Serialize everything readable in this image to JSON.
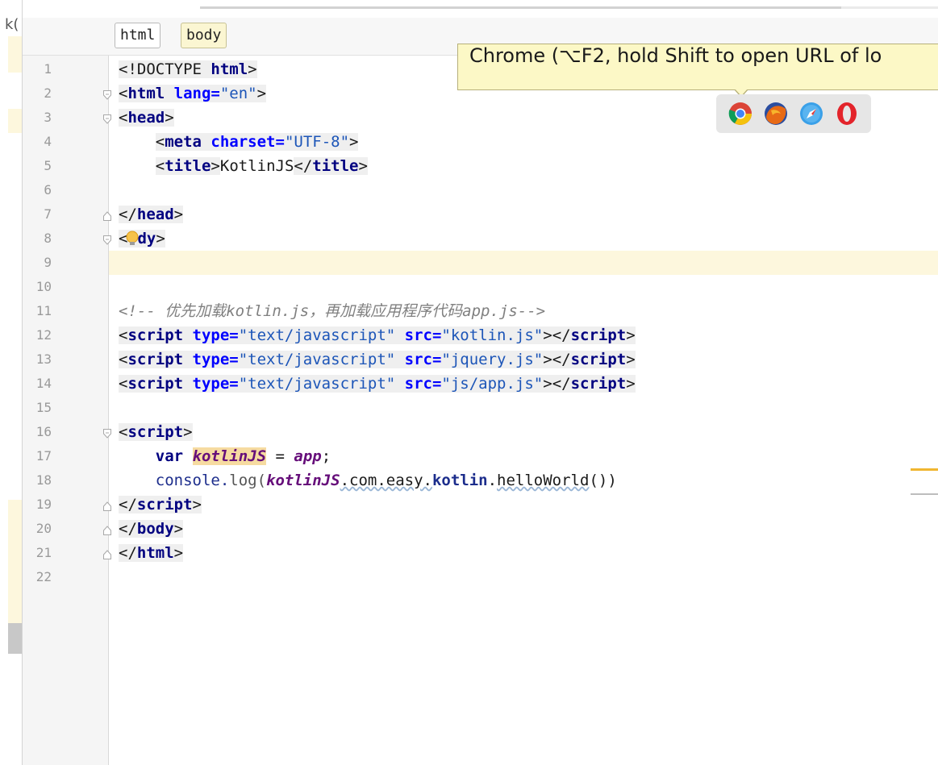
{
  "left_panel_label": "k(",
  "breadcrumbs": [
    "html",
    "body"
  ],
  "tooltip": "Chrome (⌥F2, hold Shift to open URL of lo",
  "browsers": [
    {
      "name": "chrome-icon"
    },
    {
      "name": "firefox-icon"
    },
    {
      "name": "safari-icon"
    },
    {
      "name": "opera-icon"
    }
  ],
  "line_numbers": [
    "1",
    "2",
    "3",
    "4",
    "5",
    "6",
    "7",
    "8",
    "9",
    "10",
    "11",
    "12",
    "13",
    "14",
    "15",
    "16",
    "17",
    "18",
    "19",
    "20",
    "21",
    "22"
  ],
  "code": {
    "l1_doctype": "<!DOCTYPE ",
    "l1_html": "html",
    "l1_end": ">",
    "l2_open": "<",
    "l2_tag": "html",
    "l2_attr": " lang=",
    "l2_val": "\"en\"",
    "l2_end": ">",
    "l3": "head",
    "l4_tag": "meta",
    "l4_attr": " charset=",
    "l4_val": "\"UTF-8\"",
    "l5_title_open": "title",
    "l5_text": "KotlinJS",
    "l5_title_close": "title",
    "l7": "head",
    "l8_pre": "<",
    "l8_post": "dy",
    "l11": "<!-- 优先加载kotlin.js，再加载应用程序代码app.js-->",
    "script_tag": "script",
    "type_attr": " type=",
    "type_val": "\"text/javascript\"",
    "src_attr": " src=",
    "l12_src": "\"kotlin.js\"",
    "l13_src": "\"jquery.js\"",
    "l14_src": "\"js/app.js\"",
    "l17_var": "var ",
    "l17_name": "kotlinJS",
    "l17_eq": " = ",
    "l17_app": "app",
    "l17_semi": ";",
    "l18_console": "console.",
    "l18_log": "log(",
    "l18_name": "kotlinJS",
    "l18_com": ".com.easy.",
    "l18_kotlin": "kotlin",
    "l18_dot": ".",
    "l18_fn": "helloWorld",
    "l18_end": "())",
    "l20": "body",
    "l21": "html"
  },
  "colors": {
    "caret_line": "#fdf7dd",
    "tooltip_bg": "#fcf8c6",
    "keyword": "#000080",
    "string": "#008000",
    "comment": "#808080",
    "variable": "#660e7a"
  }
}
